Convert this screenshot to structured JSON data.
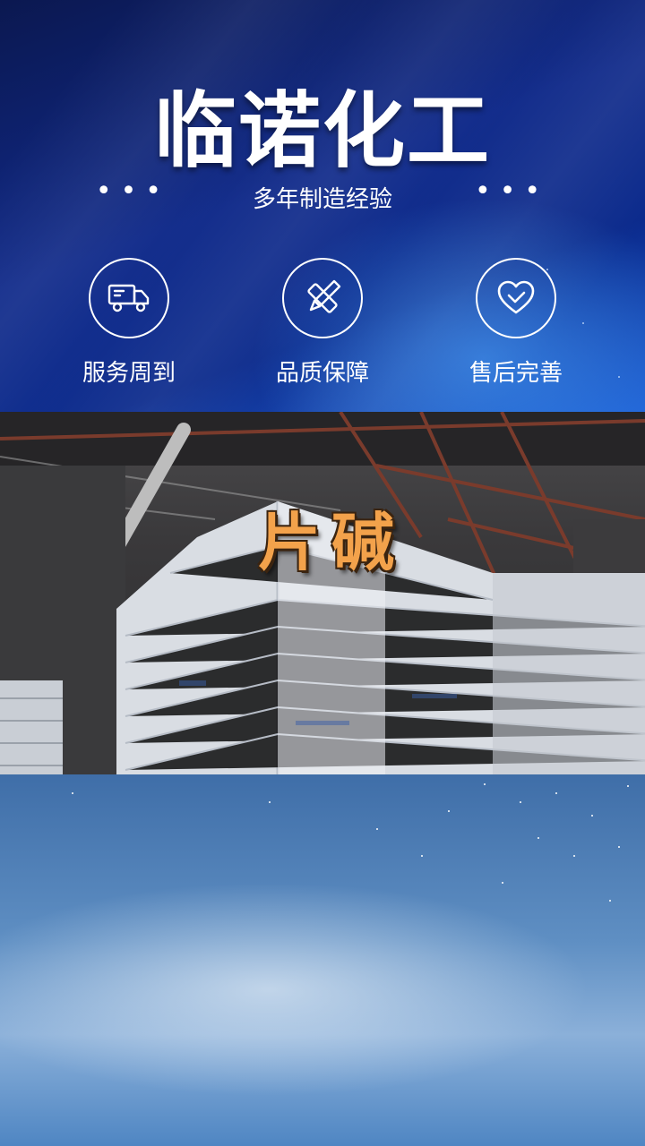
{
  "hero": {
    "title": "临诺化工",
    "subtitle": "多年制造经验",
    "dots_left": "•••",
    "dots_right": "•••",
    "features": [
      {
        "icon": "truck-icon",
        "label": "服务周到"
      },
      {
        "icon": "pencil-ruler-icon",
        "label": "品质保障"
      },
      {
        "icon": "heart-check-icon",
        "label": "售后完善"
      }
    ]
  },
  "photo": {
    "product_name": "片碱"
  },
  "colors": {
    "hero_bg": "#0b1850",
    "hero_accent": "#1d5fd4",
    "product_text": "#f3a24b",
    "sky": "#5f8fc3"
  }
}
